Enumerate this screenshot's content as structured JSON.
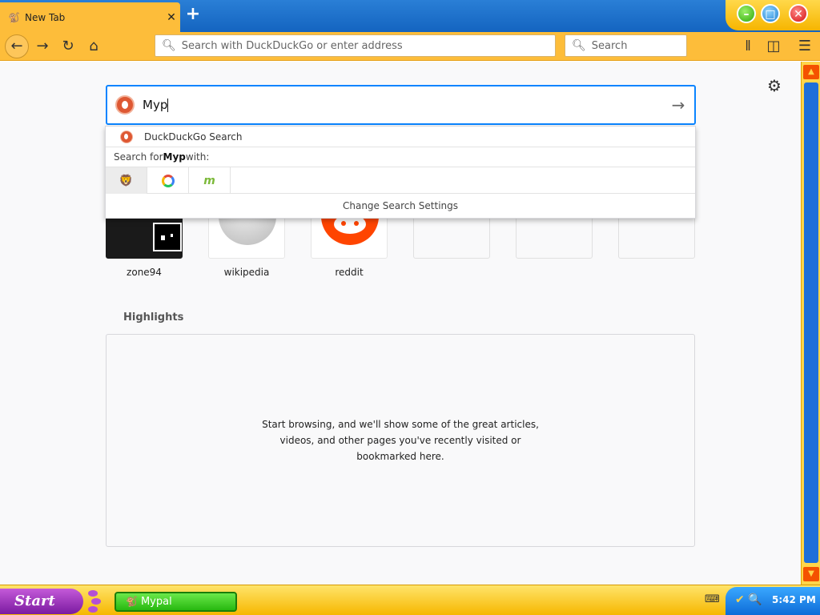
{
  "browser": {
    "tab": {
      "title": "New Tab",
      "close_glyph": "✕"
    },
    "new_tab_glyph": "+",
    "window_buttons": {
      "minimize": "–",
      "maximize": "□",
      "close": "✕"
    },
    "toolbar": {
      "back_icon": "←",
      "forward_icon": "→",
      "reload_icon": "↻",
      "home_icon": "⌂",
      "address_placeholder": "Search with DuckDuckGo or enter address",
      "search_placeholder": "Search",
      "library_icon": "𝍪",
      "sidebar_icon": "◫",
      "menu_icon": "☰"
    }
  },
  "newtab": {
    "settings_icon": "⚙",
    "search": {
      "query": "Myp",
      "go_icon": "→"
    },
    "dropdown": {
      "suggestion": "DuckDuckGo Search",
      "search_for_prefix": "Search for ",
      "search_for_term": "Myp",
      "search_for_suffix": " with:",
      "engine_brave": "🦁",
      "engine_mojeek": "m",
      "change_settings": "Change Search Settings"
    },
    "top_sites": [
      {
        "label": "zone94"
      },
      {
        "label": "wikipedia"
      },
      {
        "label": "reddit"
      }
    ],
    "highlights": {
      "title": "Highlights",
      "message": "Start browsing, and we'll show some of the great articles, videos, and other pages you've recently visited or bookmarked here."
    }
  },
  "scrollbar": {
    "up": "▲",
    "down": "▼"
  },
  "taskbar": {
    "start_label": "Start",
    "task_label": "Mypal",
    "task_icon": "🐒",
    "tray_icons": "✔ 🔍",
    "keyboard_icon": "⌨",
    "clock": "5:42 PM"
  }
}
